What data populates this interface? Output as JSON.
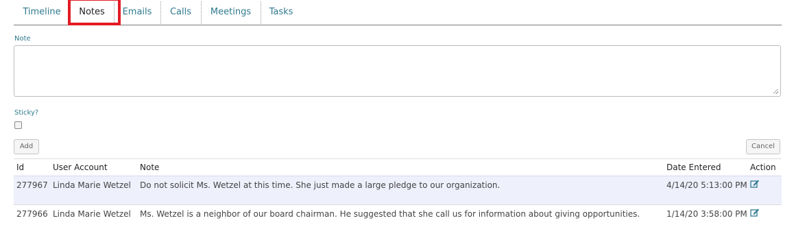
{
  "tabs": [
    {
      "label": "Timeline"
    },
    {
      "label": "Notes"
    },
    {
      "label": "Emails"
    },
    {
      "label": "Calls"
    },
    {
      "label": "Meetings"
    },
    {
      "label": "Tasks"
    }
  ],
  "active_tab": "Notes",
  "form": {
    "note_label": "Note",
    "note_value": "",
    "sticky_label": "Sticky?",
    "sticky_checked": false,
    "add_label": "Add",
    "cancel_label": "Cancel"
  },
  "table": {
    "headers": {
      "id": "Id",
      "user": "User Account",
      "note": "Note",
      "date": "Date Entered",
      "action": "Action"
    },
    "rows": [
      {
        "id": "277967",
        "user": "Linda Marie Wetzel",
        "note": "Do not solicit Ms. Wetzel at this time. She just made a large pledge to our organization.",
        "date": "4/14/20 5:13:00 PM",
        "action_icon": "edit-icon"
      },
      {
        "id": "277966",
        "user": "Linda Marie Wetzel",
        "note": "Ms. Wetzel is a neighbor of our board chairman. He suggested that she call us for information about giving opportunities.",
        "date": "1/14/20 3:58:00 PM",
        "action_icon": "edit-icon"
      }
    ]
  },
  "colors": {
    "link": "#2f7a8e",
    "highlight": "#e21b24",
    "row_alt": "#eef0fb"
  }
}
